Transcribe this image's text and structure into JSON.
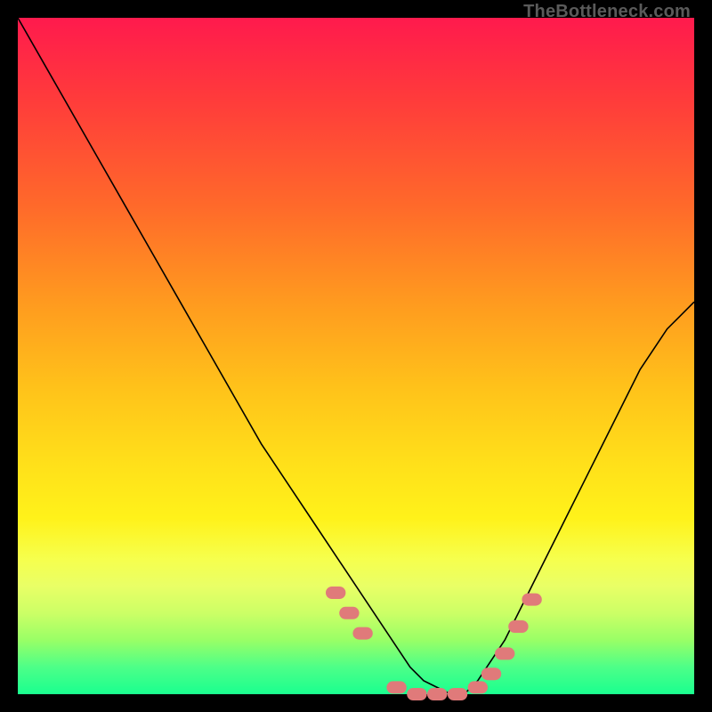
{
  "watermark": "TheBottleneck.com",
  "chart_data": {
    "type": "line",
    "title": "",
    "xlabel": "",
    "ylabel": "",
    "xlim": [
      0,
      100
    ],
    "ylim": [
      0,
      100
    ],
    "grid": false,
    "legend": false,
    "annotations": [],
    "series": [
      {
        "name": "bottleneck-curve",
        "stroke": "#000000",
        "stroke_width": 1.6,
        "x": [
          0,
          4,
          8,
          12,
          16,
          20,
          24,
          28,
          32,
          36,
          40,
          44,
          48,
          52,
          56,
          58,
          60,
          62,
          64,
          66,
          68,
          72,
          76,
          80,
          84,
          88,
          92,
          96,
          100
        ],
        "y": [
          100,
          93,
          86,
          79,
          72,
          65,
          58,
          51,
          44,
          37,
          31,
          25,
          19,
          13,
          7,
          4,
          2,
          1,
          0,
          0,
          2,
          8,
          16,
          24,
          32,
          40,
          48,
          54,
          58
        ]
      },
      {
        "name": "highlight-markers",
        "marker_color": "#e07a7a",
        "marker_radius": 7,
        "x": [
          47,
          49,
          51,
          56,
          59,
          62,
          65,
          68,
          70,
          72,
          74,
          76
        ],
        "y": [
          15,
          12,
          9,
          1,
          0,
          0,
          0,
          1,
          3,
          6,
          10,
          14
        ]
      }
    ]
  }
}
